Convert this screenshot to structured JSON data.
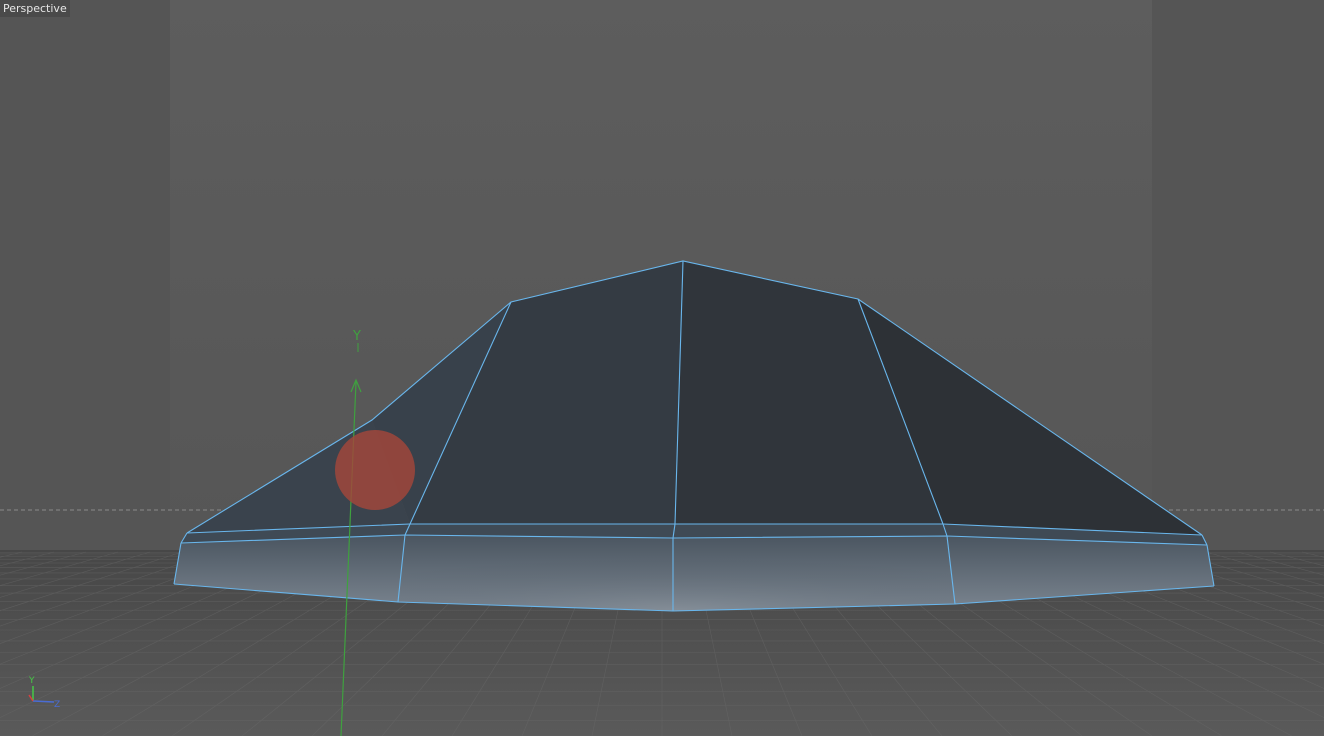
{
  "viewport": {
    "label": "Perspective",
    "background": "#5a5a5a"
  },
  "gizmo": {
    "y_label": "Y",
    "y_color": "#3fa13f"
  },
  "axis_indicator": {
    "y_label": "Y",
    "z_label": "Z",
    "y_color": "#46c846",
    "z_color": "#4a6cd4",
    "x_color": "#d84040"
  },
  "object": {
    "wire_color": "#69b6ec",
    "surface_color": "#33383e"
  },
  "cursor": {
    "color": "#a4473a"
  }
}
